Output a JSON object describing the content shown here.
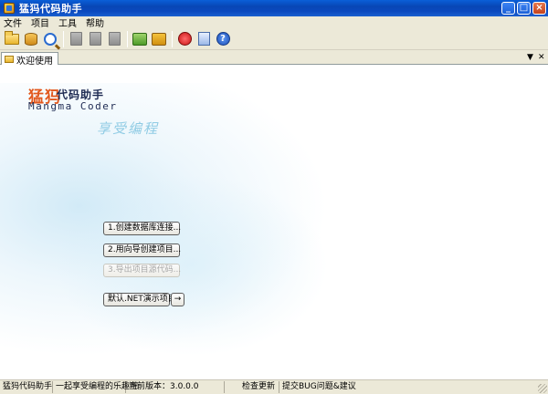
{
  "window": {
    "title": "猛犸代码助手"
  },
  "menu": {
    "items": [
      "文件",
      "项目",
      "工具",
      "帮助"
    ]
  },
  "tabs": {
    "active": "欢迎使用"
  },
  "welcome": {
    "logo_cn_part1": "猛犸",
    "logo_cn_part2": "代码助手",
    "logo_en": "Mangma Coder",
    "slogan": "享受编程"
  },
  "actions": {
    "create_db_connection": "1.创建数据库连接...",
    "wizard_create_project": "2.用向导创建项目...",
    "export_project_code": "3.导出项目源代码...",
    "default_demo_project": "默认.NET演示项目...",
    "go": "→"
  },
  "status": {
    "app": "猛犸代码助手",
    "tagline": "一起享受编程的乐趣吧",
    "version": "当前版本：3.0.0.0",
    "check_update": "检查更新",
    "feedback": "提交BUG问题&建议"
  }
}
